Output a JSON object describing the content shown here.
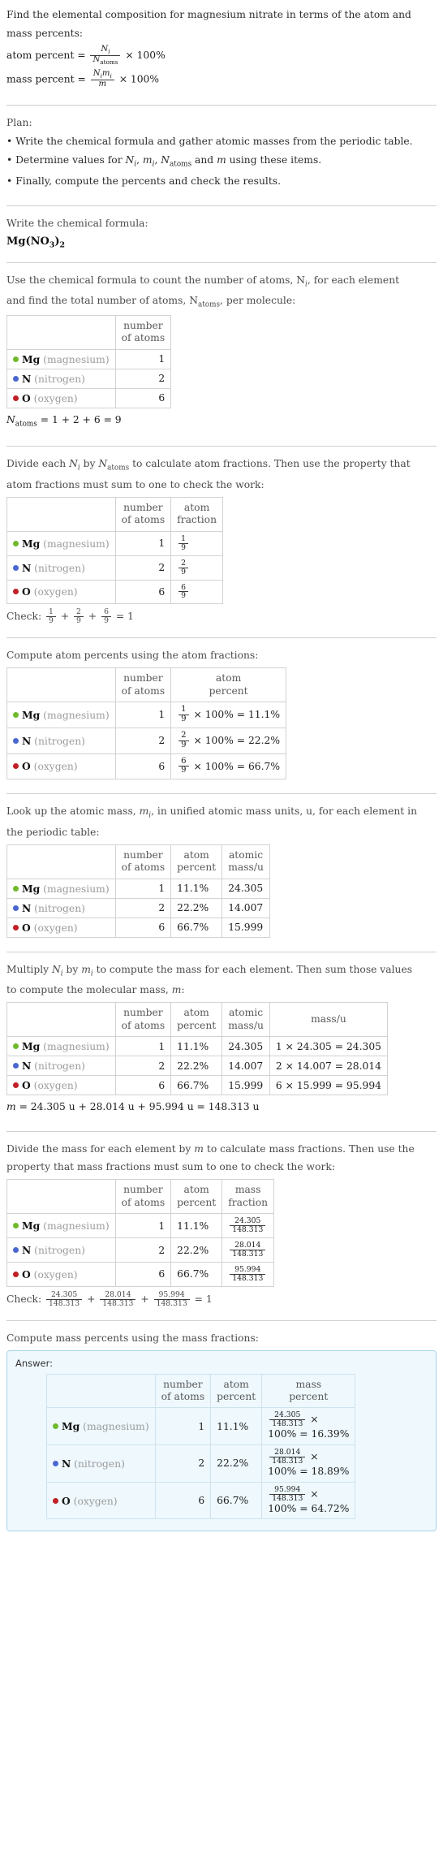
{
  "intro": {
    "line1": "Find the elemental composition for magnesium nitrate in terms of the atom and",
    "line2": "mass percents:",
    "atom_percent_label": "atom percent =",
    "mass_percent_label": "mass percent =",
    "times100": "× 100%"
  },
  "plan": {
    "heading": "Plan:",
    "bullets": [
      "Write the chemical formula and gather atomic masses from the periodic table.",
      "Determine values for N_i, m_i, N_atoms and m using these items.",
      "Finally, compute the percents and check the results."
    ],
    "bullet3": "Finally, compute the percents and check the results."
  },
  "step_formula": {
    "prompt": "Write the chemical formula:",
    "formula": "Mg(NO3)2",
    "formula_parts": {
      "mg": "Mg",
      "open": "(",
      "n": "N",
      "o": "O",
      "o_sub": "3",
      "close": ")",
      "close_sub": "2"
    }
  },
  "step_count": {
    "prompt_line1": "Use the chemical formula to count the number of atoms, N",
    "prompt_line1_sub": "i",
    "prompt_line1_end": ", for each element",
    "prompt_line2": "and find the total number of atoms, N",
    "prompt_line2_sub": "atoms",
    "prompt_line2_end": ", per molecule:",
    "header_number_of_atoms": [
      "number",
      "of atoms"
    ],
    "total_line": "N_atoms = 1 + 2 + 6 = 9",
    "total_expr": "= 1 + 2 + 6 = 9"
  },
  "elements": [
    {
      "symbol": "Mg",
      "name": "(magnesium)",
      "color": "#6fba2c",
      "atoms": "1",
      "fraction_num": "1",
      "fraction_den": "9",
      "atom_percent": "11.1%",
      "atomic_mass": "24.305",
      "mass_expr": "1 × 24.305 = 24.305",
      "mass_value": "24.305",
      "mass_percent": "16.39%"
    },
    {
      "symbol": "N",
      "name": "(nitrogen)",
      "color": "#4a67cf",
      "atoms": "2",
      "fraction_num": "2",
      "fraction_den": "9",
      "atom_percent": "22.2%",
      "atomic_mass": "14.007",
      "mass_expr": "2 × 14.007 = 28.014",
      "mass_value": "28.014",
      "mass_percent": "18.89%"
    },
    {
      "symbol": "O",
      "name": "(oxygen)",
      "color": "#bf2026",
      "atoms": "6",
      "fraction_num": "6",
      "fraction_den": "9",
      "atom_percent": "66.7%",
      "atomic_mass": "15.999",
      "mass_expr": "6 × 15.999 = 95.994",
      "mass_value": "95.994",
      "mass_percent": "64.72%"
    }
  ],
  "step_fraction": {
    "prompt_line1": "Divide each N_i by N_atoms to calculate atom fractions. Then use the property that",
    "prompt_line2": "atom fractions must sum to one to check the work:",
    "header_atom_fraction": [
      "atom",
      "fraction"
    ],
    "check_label": "Check:",
    "check_result": "= 1"
  },
  "step_atom_percent": {
    "prompt": "Compute atom percents using the atom fractions:",
    "header_atom_percent": [
      "atom",
      "percent"
    ],
    "results": [
      "× 100% = 11.1%",
      "× 100% = 22.2%",
      "× 100% = 66.7%"
    ]
  },
  "step_atomic_mass": {
    "prompt_line1": "Look up the atomic mass, m_i, in unified atomic mass units, u, for each element in",
    "prompt_line2": "the periodic table:",
    "header_atomic_mass": [
      "atomic",
      "mass/u"
    ]
  },
  "step_molecular_mass": {
    "prompt_line1": "Multiply N_i by m_i to compute the mass for each element. Then sum those values",
    "prompt_line2": "to compute the molecular mass, m:",
    "header_mass": [
      "mass/u"
    ],
    "total": "m = 24.305 u + 28.014 u + 95.994 u = 148.313 u",
    "total_value": "148.313",
    "total_rest": "= 24.305 u + 28.014 u + 95.994 u = 148.313 u"
  },
  "step_mass_fraction": {
    "prompt_line1": "Divide the mass for each element by m to calculate mass fractions. Then use the",
    "prompt_line2": "property that mass fractions must sum to one to check the work:",
    "header_mass_fraction": [
      "mass",
      "fraction"
    ],
    "denominator": "148.313",
    "check_label": "Check:",
    "check_result": "= 1"
  },
  "step_answer": {
    "prompt": "Compute mass percents using the mass fractions:",
    "answer_label": "Answer:",
    "header_mass_percent": [
      "mass",
      "percent"
    ],
    "denominator": "148.313",
    "tail": "100% ="
  },
  "symbols": {
    "N": "N",
    "m": "m",
    "i": "i",
    "atoms": "atoms",
    "times": "×",
    "plus": "+",
    "equals": "=",
    "percent100": "100%",
    "u": "u"
  },
  "colors": {
    "magnesium": "#6fba2c",
    "nitrogen": "#4a67cf",
    "oxygen": "#bf2026",
    "answer_bg": "#eef8fd",
    "answer_border": "#a7d4e8",
    "rule": "#cfcfcf"
  }
}
